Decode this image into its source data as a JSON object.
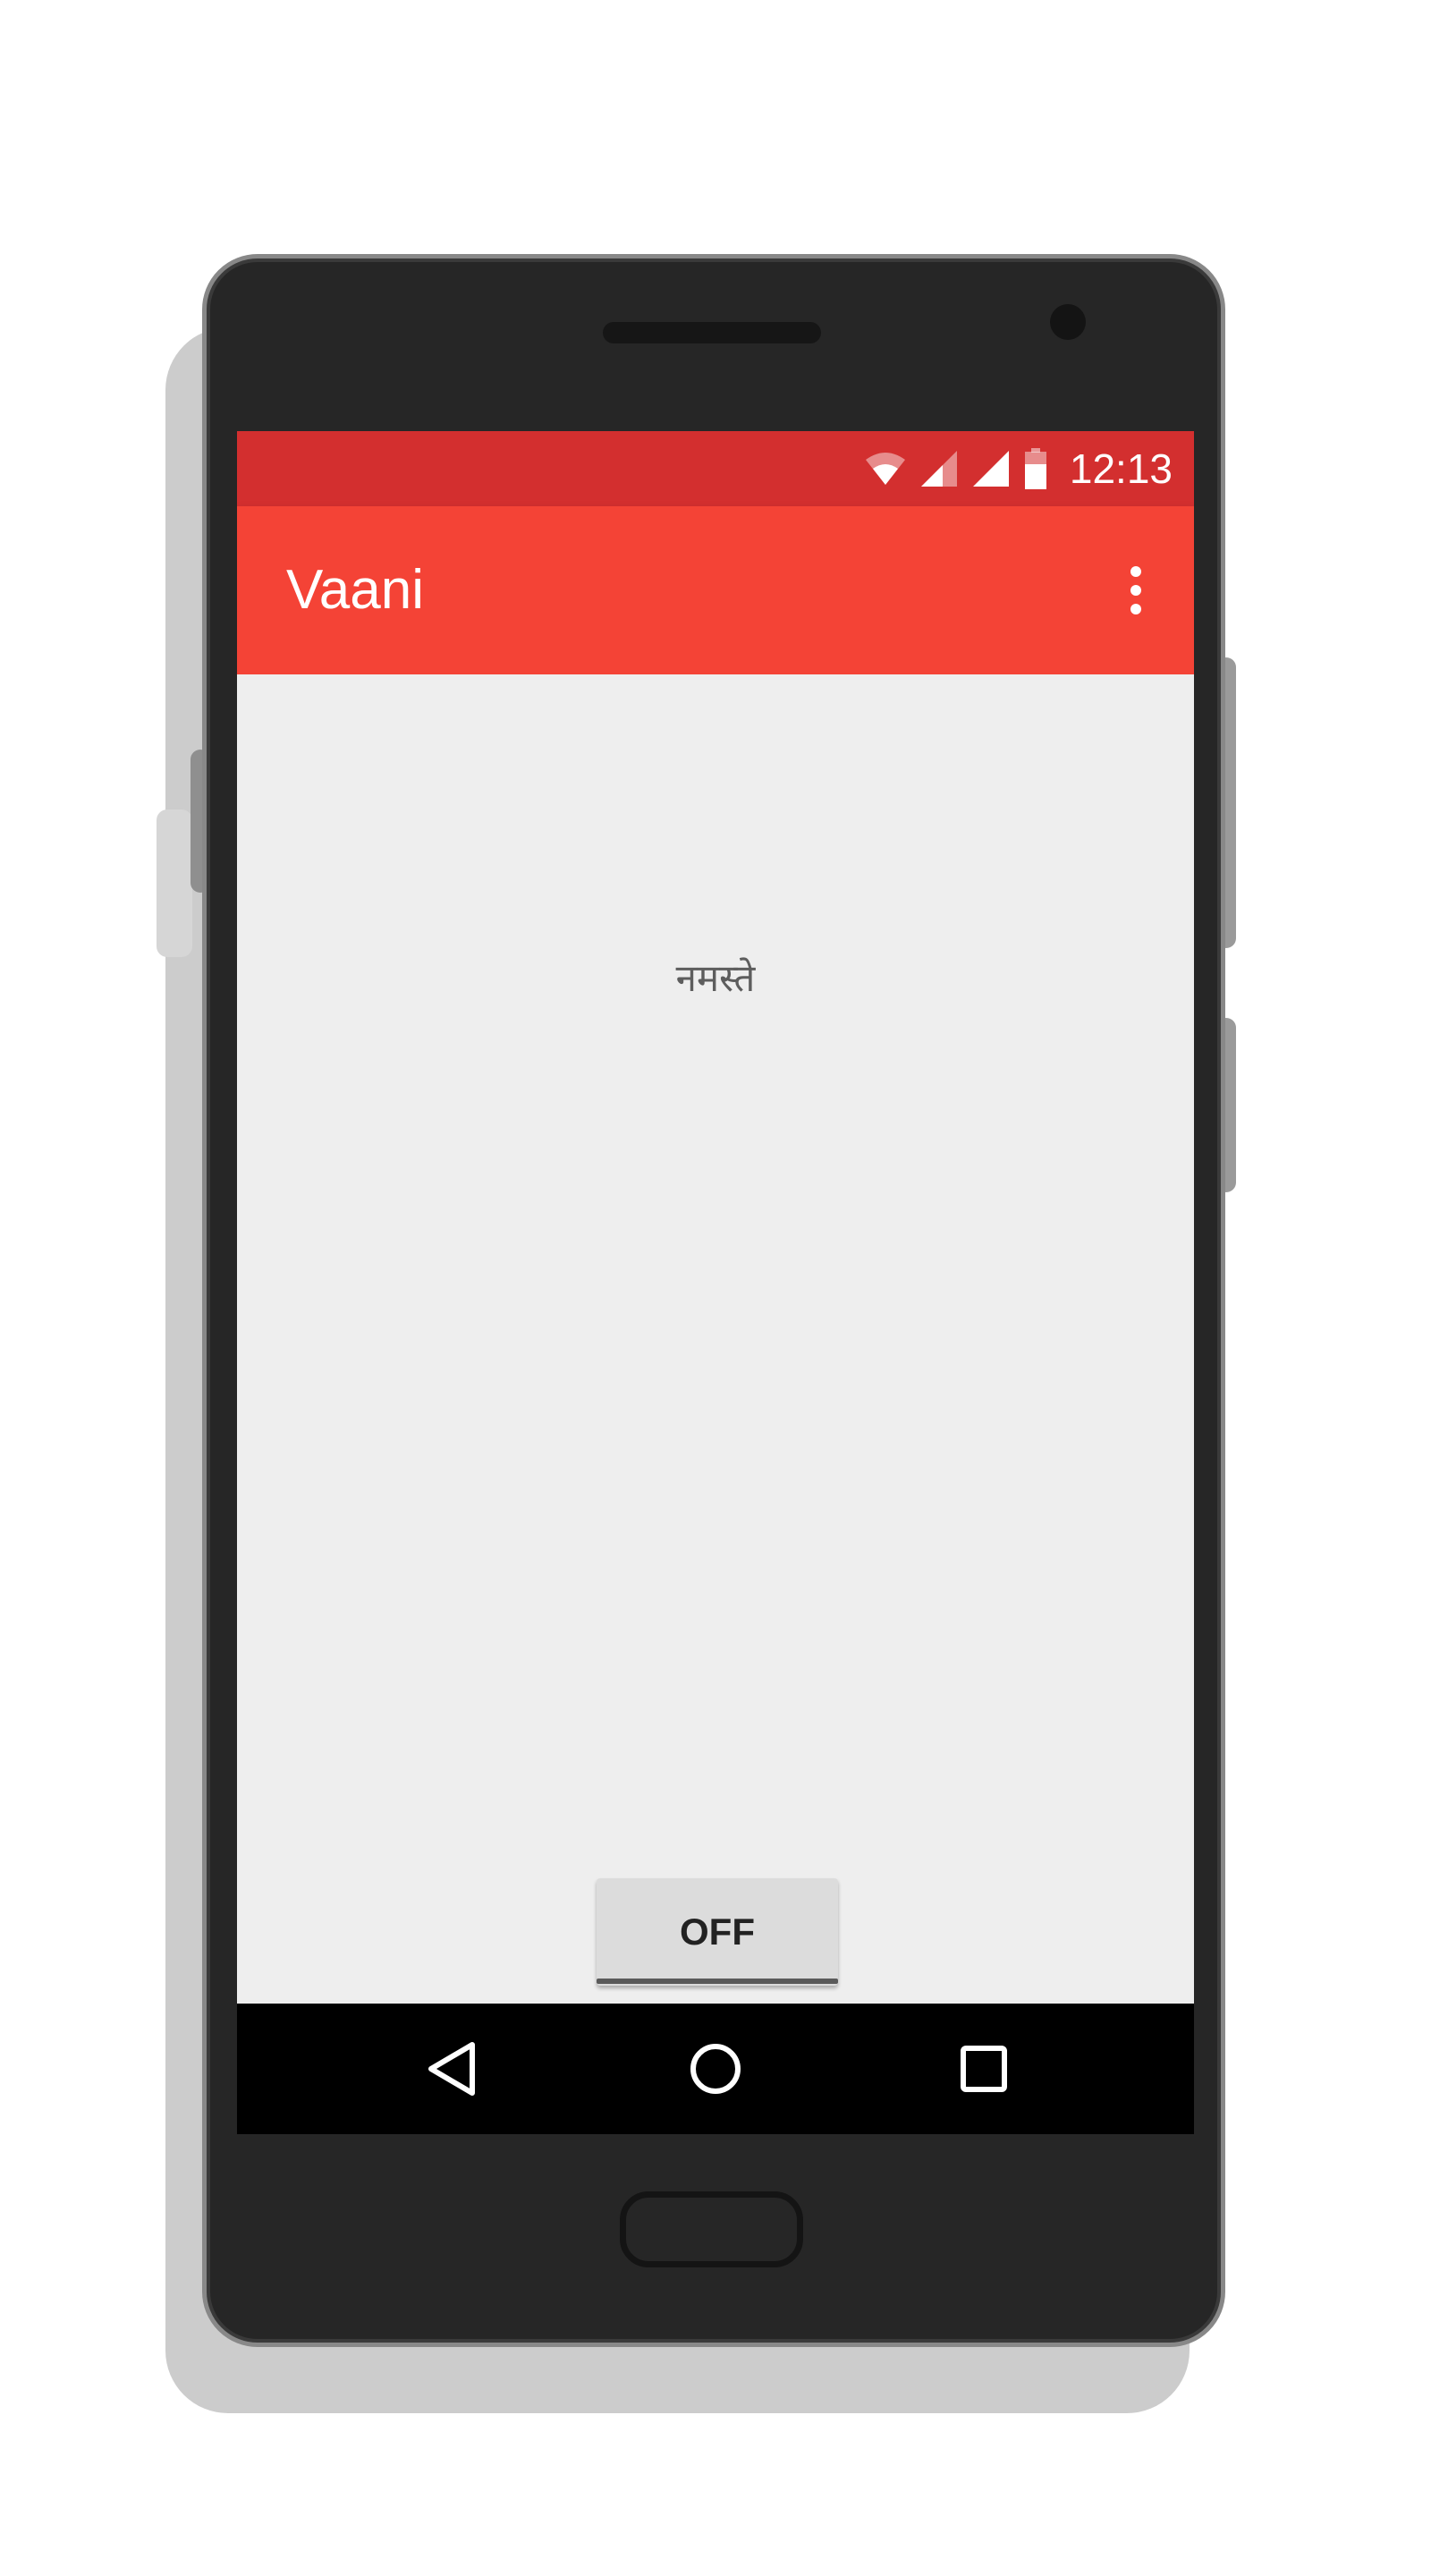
{
  "status_bar": {
    "time": "12:13",
    "icons": [
      "wifi-icon",
      "signal-icon",
      "signal-icon",
      "battery-icon"
    ],
    "color": "#d32f2f"
  },
  "toolbar": {
    "title": "Vaani",
    "overflow_icon": "more-vert-icon",
    "color": "#f44336"
  },
  "content": {
    "greeting": "नमस्ते",
    "toggle_label": "OFF"
  },
  "nav_bar": {
    "icons": [
      "back-icon",
      "home-icon",
      "recents-icon"
    ]
  }
}
